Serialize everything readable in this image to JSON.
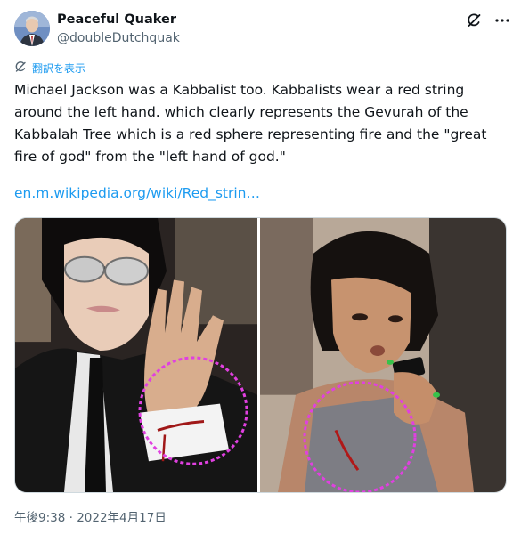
{
  "author": {
    "display_name": "Peaceful Quaker",
    "handle": "@doubleDutchquak"
  },
  "header_icons": [
    "grok-icon",
    "more-icon"
  ],
  "translate_label": "翻訳を表示",
  "tweet": {
    "text": "Michael Jackson was a Kabbalist too. Kabbalists wear a red string around the left hand. which clearly represents the Gevurah of the Kabbalah Tree which is a red sphere representing fire and the \"great fire of god\" from the \"left hand of god.\"",
    "link": "en.m.wikipedia.org/wiki/Red_strin…"
  },
  "timestamp": "午後9:38 · 2022年4月17日",
  "colors": {
    "link": "#1d9bf0",
    "secondary_text": "#536471",
    "highlight_circle": "#e040e0"
  }
}
